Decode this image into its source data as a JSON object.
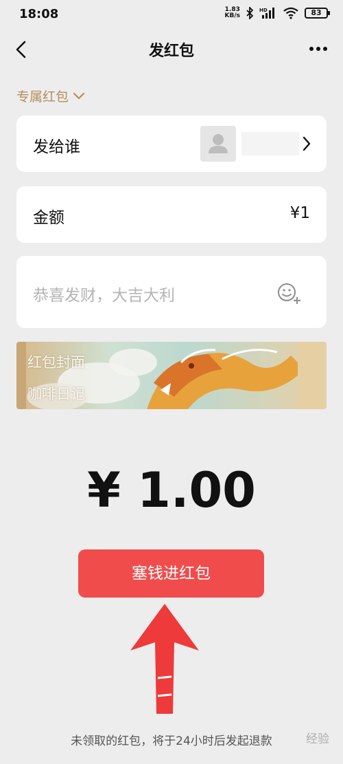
{
  "status": {
    "time": "18:08",
    "net_speed_top": "1.83",
    "net_speed_bottom": "KB/s",
    "battery": "83"
  },
  "nav": {
    "title": "发红包"
  },
  "exclusive": {
    "label": "专属红包"
  },
  "recipient": {
    "label": "发给谁"
  },
  "amount": {
    "label": "金额",
    "value": "¥1"
  },
  "greeting": {
    "placeholder": "恭喜发财，大吉大利"
  },
  "cover": {
    "title": "红包封面",
    "subtitle": "咖啡日记"
  },
  "total": {
    "display": "¥ 1.00"
  },
  "send_button": {
    "label": "塞钱进红包"
  },
  "footer": {
    "note": "未领取的红包，将于24小时后发起退款"
  },
  "watermark": {
    "text": "经验"
  },
  "colors": {
    "background": "#ededed",
    "accent_red": "#f04c4c",
    "exclusive_gold": "#b58e5a",
    "arrow_red": "#ee3a3a"
  }
}
